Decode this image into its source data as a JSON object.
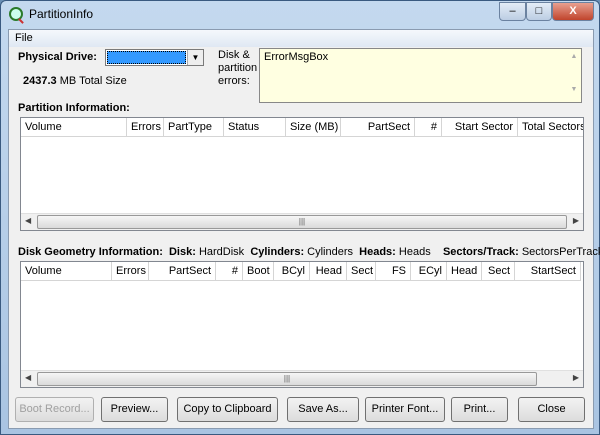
{
  "window": {
    "title": "PartitionInfo",
    "min": "–",
    "max": "□",
    "close": "X"
  },
  "menu": {
    "file": "File"
  },
  "drive": {
    "label": "Physical Drive:",
    "size": "2437.3",
    "size_unit": "MB Total Size"
  },
  "errors": {
    "label1": "Disk &",
    "label2": "partition",
    "label3": "errors:",
    "value": "ErrorMsgBox"
  },
  "partition": {
    "title": "Partition Information:",
    "columns": [
      "Volume",
      "Errors",
      "PartType",
      "Status",
      "Size (MB)",
      "PartSect",
      "#",
      "Start Sector",
      "Total Sectors"
    ]
  },
  "geometry": {
    "title": "Disk Geometry Information:",
    "disk_label": "Disk:",
    "disk": "HardDisk",
    "cyl_label": "Cylinders:",
    "cyl": "Cylinders",
    "heads_label": "Heads:",
    "heads": "Heads",
    "spt_label": "Sectors/Track:",
    "spt": "SectorsPerTrack",
    "columns": [
      "Volume",
      "Errors",
      "PartSect",
      "#",
      "Boot",
      "BCyl",
      "Head",
      "Sect",
      "FS",
      "ECyl",
      "Head",
      "Sect",
      "StartSect"
    ]
  },
  "buttons": {
    "boot": "Boot Record...",
    "preview": "Preview...",
    "copy": "Copy to Clipboard",
    "save": "Save As...",
    "font": "Printer Font...",
    "print": "Print...",
    "close": "Close"
  }
}
